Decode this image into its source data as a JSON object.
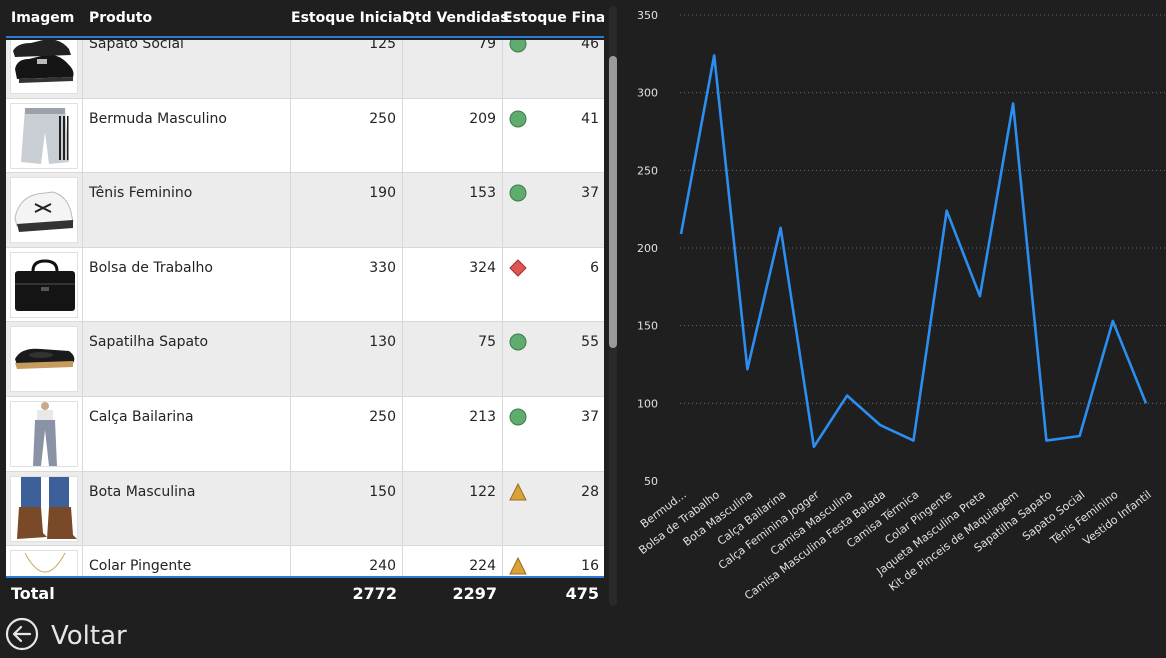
{
  "table": {
    "headers": {
      "image": "Imagem",
      "product": "Produto",
      "initial_stock": "Estoque Inicial",
      "sold": "Qtd Vendidas",
      "final_stock": "Estoque Final"
    },
    "rows": [
      {
        "product": "Sapato Social",
        "initial": "125",
        "sold": "79",
        "final": "46",
        "status": "green",
        "image_icon": "shoe-icon"
      },
      {
        "product": "Bermuda Masculino",
        "initial": "250",
        "sold": "209",
        "final": "41",
        "status": "green",
        "image_icon": "shorts-icon"
      },
      {
        "product": "Tênis Feminino",
        "initial": "190",
        "sold": "153",
        "final": "37",
        "status": "green",
        "image_icon": "sneaker-icon"
      },
      {
        "product": "Bolsa de Trabalho",
        "initial": "330",
        "sold": "324",
        "final": "6",
        "status": "red",
        "image_icon": "bag-icon"
      },
      {
        "product": "Sapatilha Sapato",
        "initial": "130",
        "sold": "75",
        "final": "55",
        "status": "green",
        "image_icon": "flat-shoe-icon"
      },
      {
        "product": "Calça Bailarina",
        "initial": "250",
        "sold": "213",
        "final": "37",
        "status": "green",
        "image_icon": "pants-icon"
      },
      {
        "product": "Bota Masculina",
        "initial": "150",
        "sold": "122",
        "final": "28",
        "status": "yellow",
        "image_icon": "boots-icon"
      },
      {
        "product": "Colar Pingente",
        "initial": "240",
        "sold": "224",
        "final": "16",
        "status": "yellow",
        "image_icon": "necklace-icon"
      }
    ],
    "totals": {
      "label": "Total",
      "initial": "2772",
      "sold": "2297",
      "final": "475"
    },
    "status_colors": {
      "green": "#5fad6e",
      "red": "#e05552",
      "yellow": "#d9a13b"
    }
  },
  "back_button": {
    "label": "Voltar",
    "icon": "arrow-left-circle-icon"
  },
  "chart_data": {
    "type": "line",
    "categories": [
      "Bermud...",
      "Bolsa de Trabalho",
      "Bota Masculina",
      "Calça Bailarina",
      "Calça Feminina Jogger",
      "Camisa Masculina",
      "Camisa Masculina Festa Balada",
      "Camisa Térmica",
      "Colar Pingente",
      "Jaqueta Masculina Preta",
      "Kit de Pinceis de Maquiagem",
      "Sapatilha Sapato",
      "Sapato Social",
      "Tênis Feminino",
      "Vestido Infantil"
    ],
    "series": [
      {
        "values": [
          209,
          324,
          122,
          213,
          72,
          105,
          86,
          76,
          224,
          169,
          293,
          76,
          79,
          153,
          100
        ],
        "color": "#2b8ef0"
      }
    ],
    "yticks": [
      50,
      100,
      150,
      200,
      250,
      300,
      350
    ],
    "ylim": [
      50,
      350
    ],
    "grid": true,
    "gridline_color": "#6a6a6a",
    "text_color": "#e0e0e0"
  }
}
